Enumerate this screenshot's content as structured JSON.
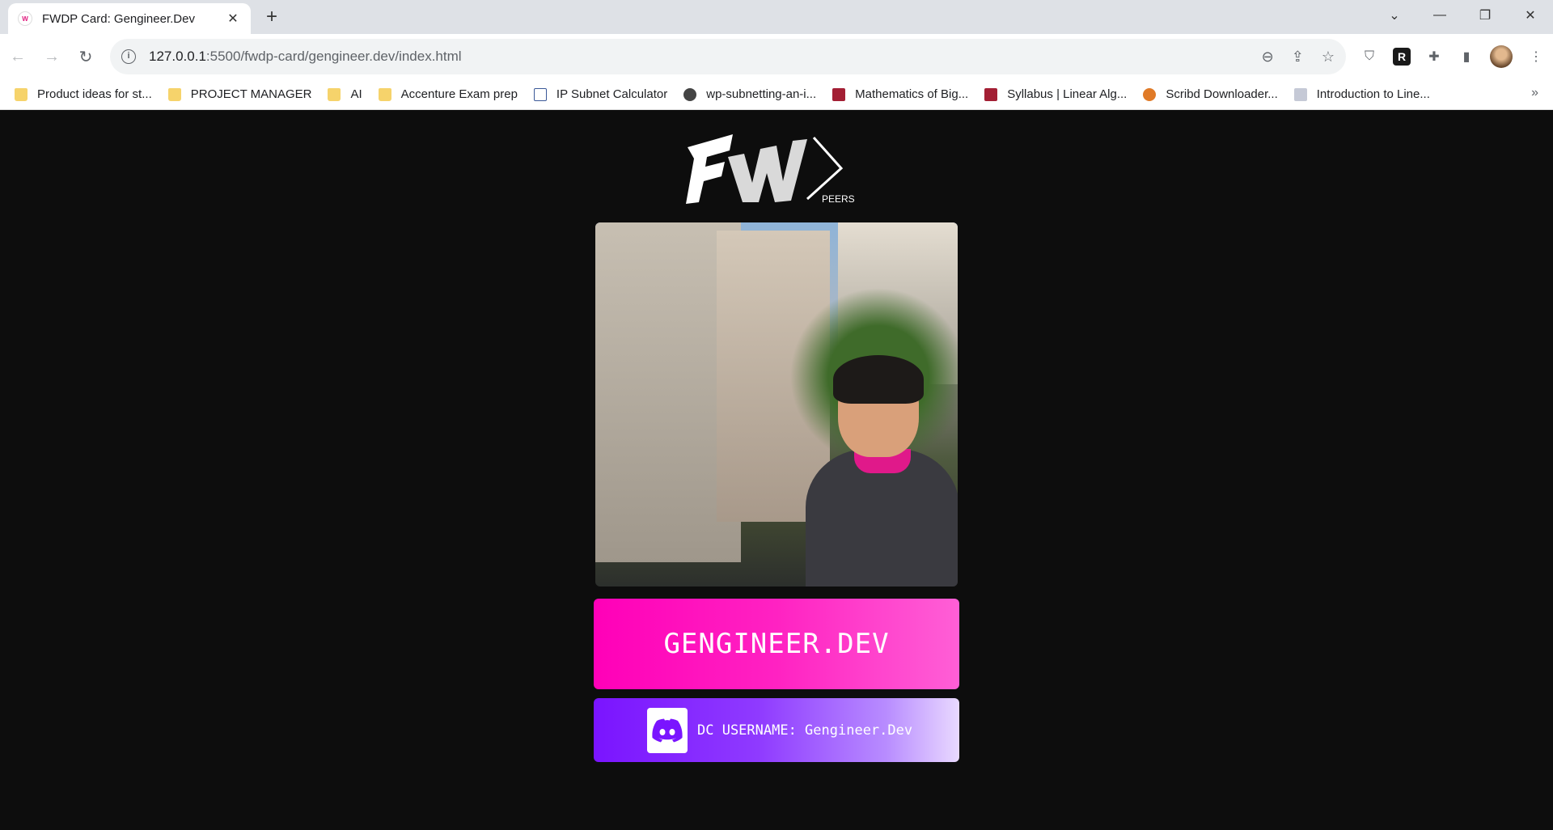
{
  "tab": {
    "title": "FWDP Card: Gengineer.Dev",
    "favicon": "W"
  },
  "omnibox": {
    "host": "127.0.0.1",
    "rest": ":5500/fwdp-card/gengineer.dev/index.html"
  },
  "bookmarks": [
    {
      "label": "Product ideas for st...",
      "icon": "folder"
    },
    {
      "label": "PROJECT MANAGER",
      "icon": "folder"
    },
    {
      "label": "AI",
      "icon": "folder"
    },
    {
      "label": "Accenture Exam prep",
      "icon": "folder"
    },
    {
      "label": "IP Subnet Calculator",
      "icon": "calc"
    },
    {
      "label": "wp-subnetting-an-i...",
      "icon": "globe"
    },
    {
      "label": "Mathematics of Big...",
      "icon": "mit"
    },
    {
      "label": "Syllabus | Linear Alg...",
      "icon": "mit"
    },
    {
      "label": "Scribd Downloader...",
      "icon": "scribd"
    },
    {
      "label": "Introduction to Line...",
      "icon": "math"
    }
  ],
  "bookmarks_more": "»",
  "logo": {
    "mark": "FW",
    "sub": "PEERS"
  },
  "card": {
    "name": "GENGINEER.DEV",
    "discord_label": "DC USERNAME: Gengineer.Dev"
  },
  "colors": {
    "name_card": "#ff00b8",
    "discord_card": "#7a14ff",
    "page_bg": "#0d0d0d"
  }
}
